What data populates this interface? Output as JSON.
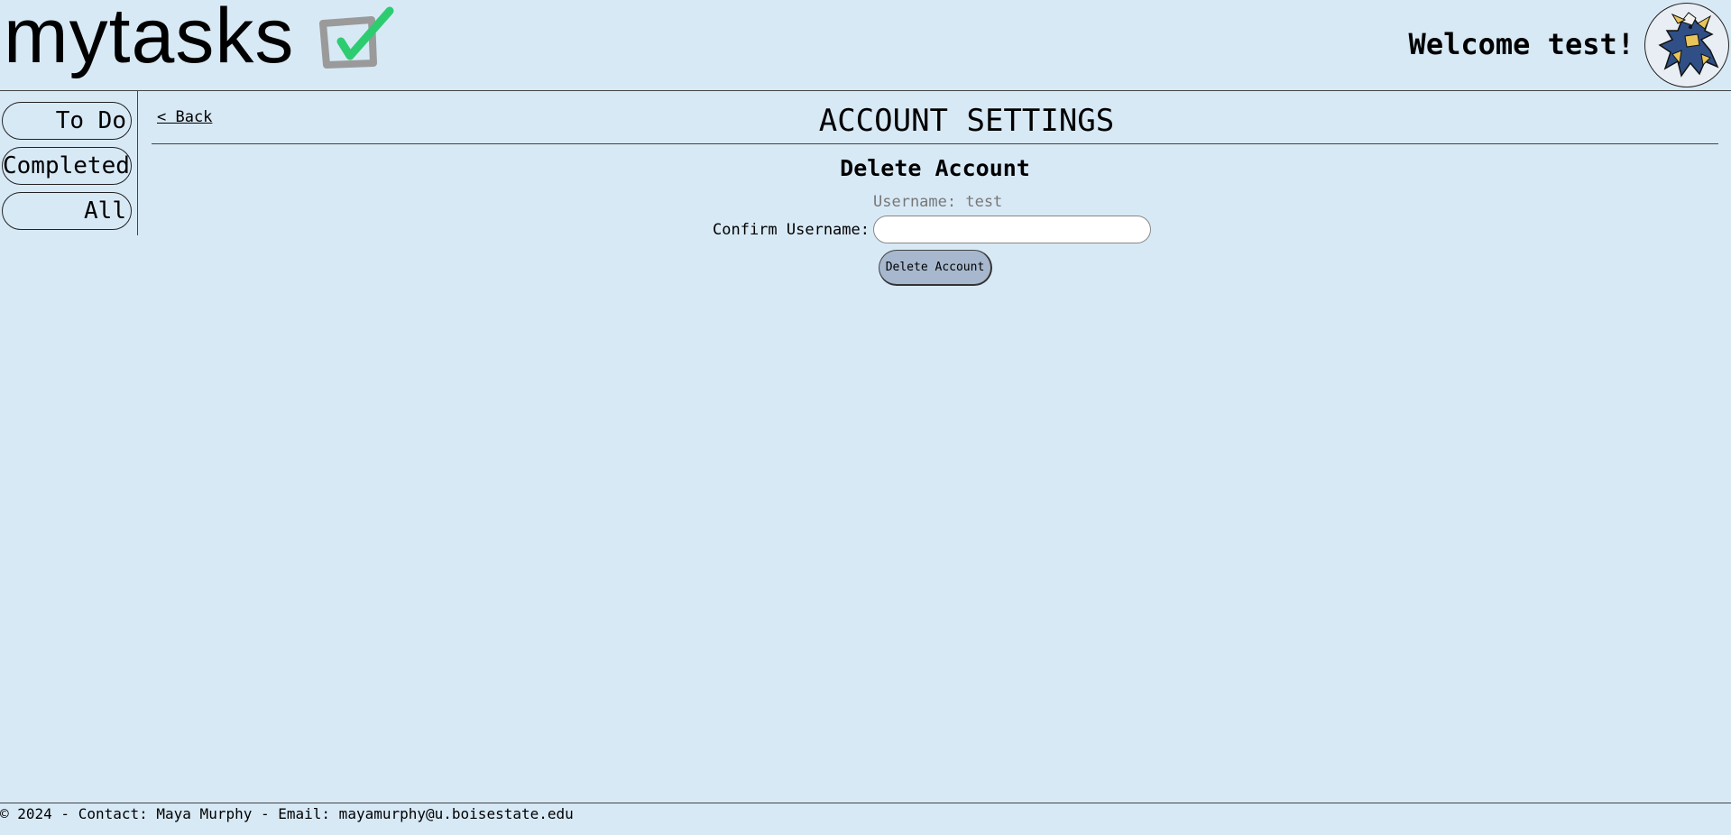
{
  "header": {
    "logo_text": "mytasks",
    "logo_icon": "checkbox-check-icon",
    "welcome": "Welcome test!",
    "avatar_icon": "user-avatar-creature"
  },
  "sidebar": {
    "items": [
      {
        "label": "To Do"
      },
      {
        "label": "Completed"
      },
      {
        "label": "All"
      }
    ]
  },
  "main": {
    "back_label": "< Back",
    "title": "ACCOUNT SETTINGS",
    "section_title": "Delete Account",
    "username_line": "Username: test",
    "confirm_label": "Confirm Username:",
    "confirm_value": "",
    "delete_button": "Delete Account"
  },
  "footer": {
    "text": "© 2024 - Contact: Maya Murphy - Email: mayamurphy@u.boisestate.edu"
  },
  "colors": {
    "background": "#d8e9f6",
    "button_fill": "#a7b8ce",
    "check_green": "#2ecc71",
    "box_gray": "#9a9a9a"
  }
}
